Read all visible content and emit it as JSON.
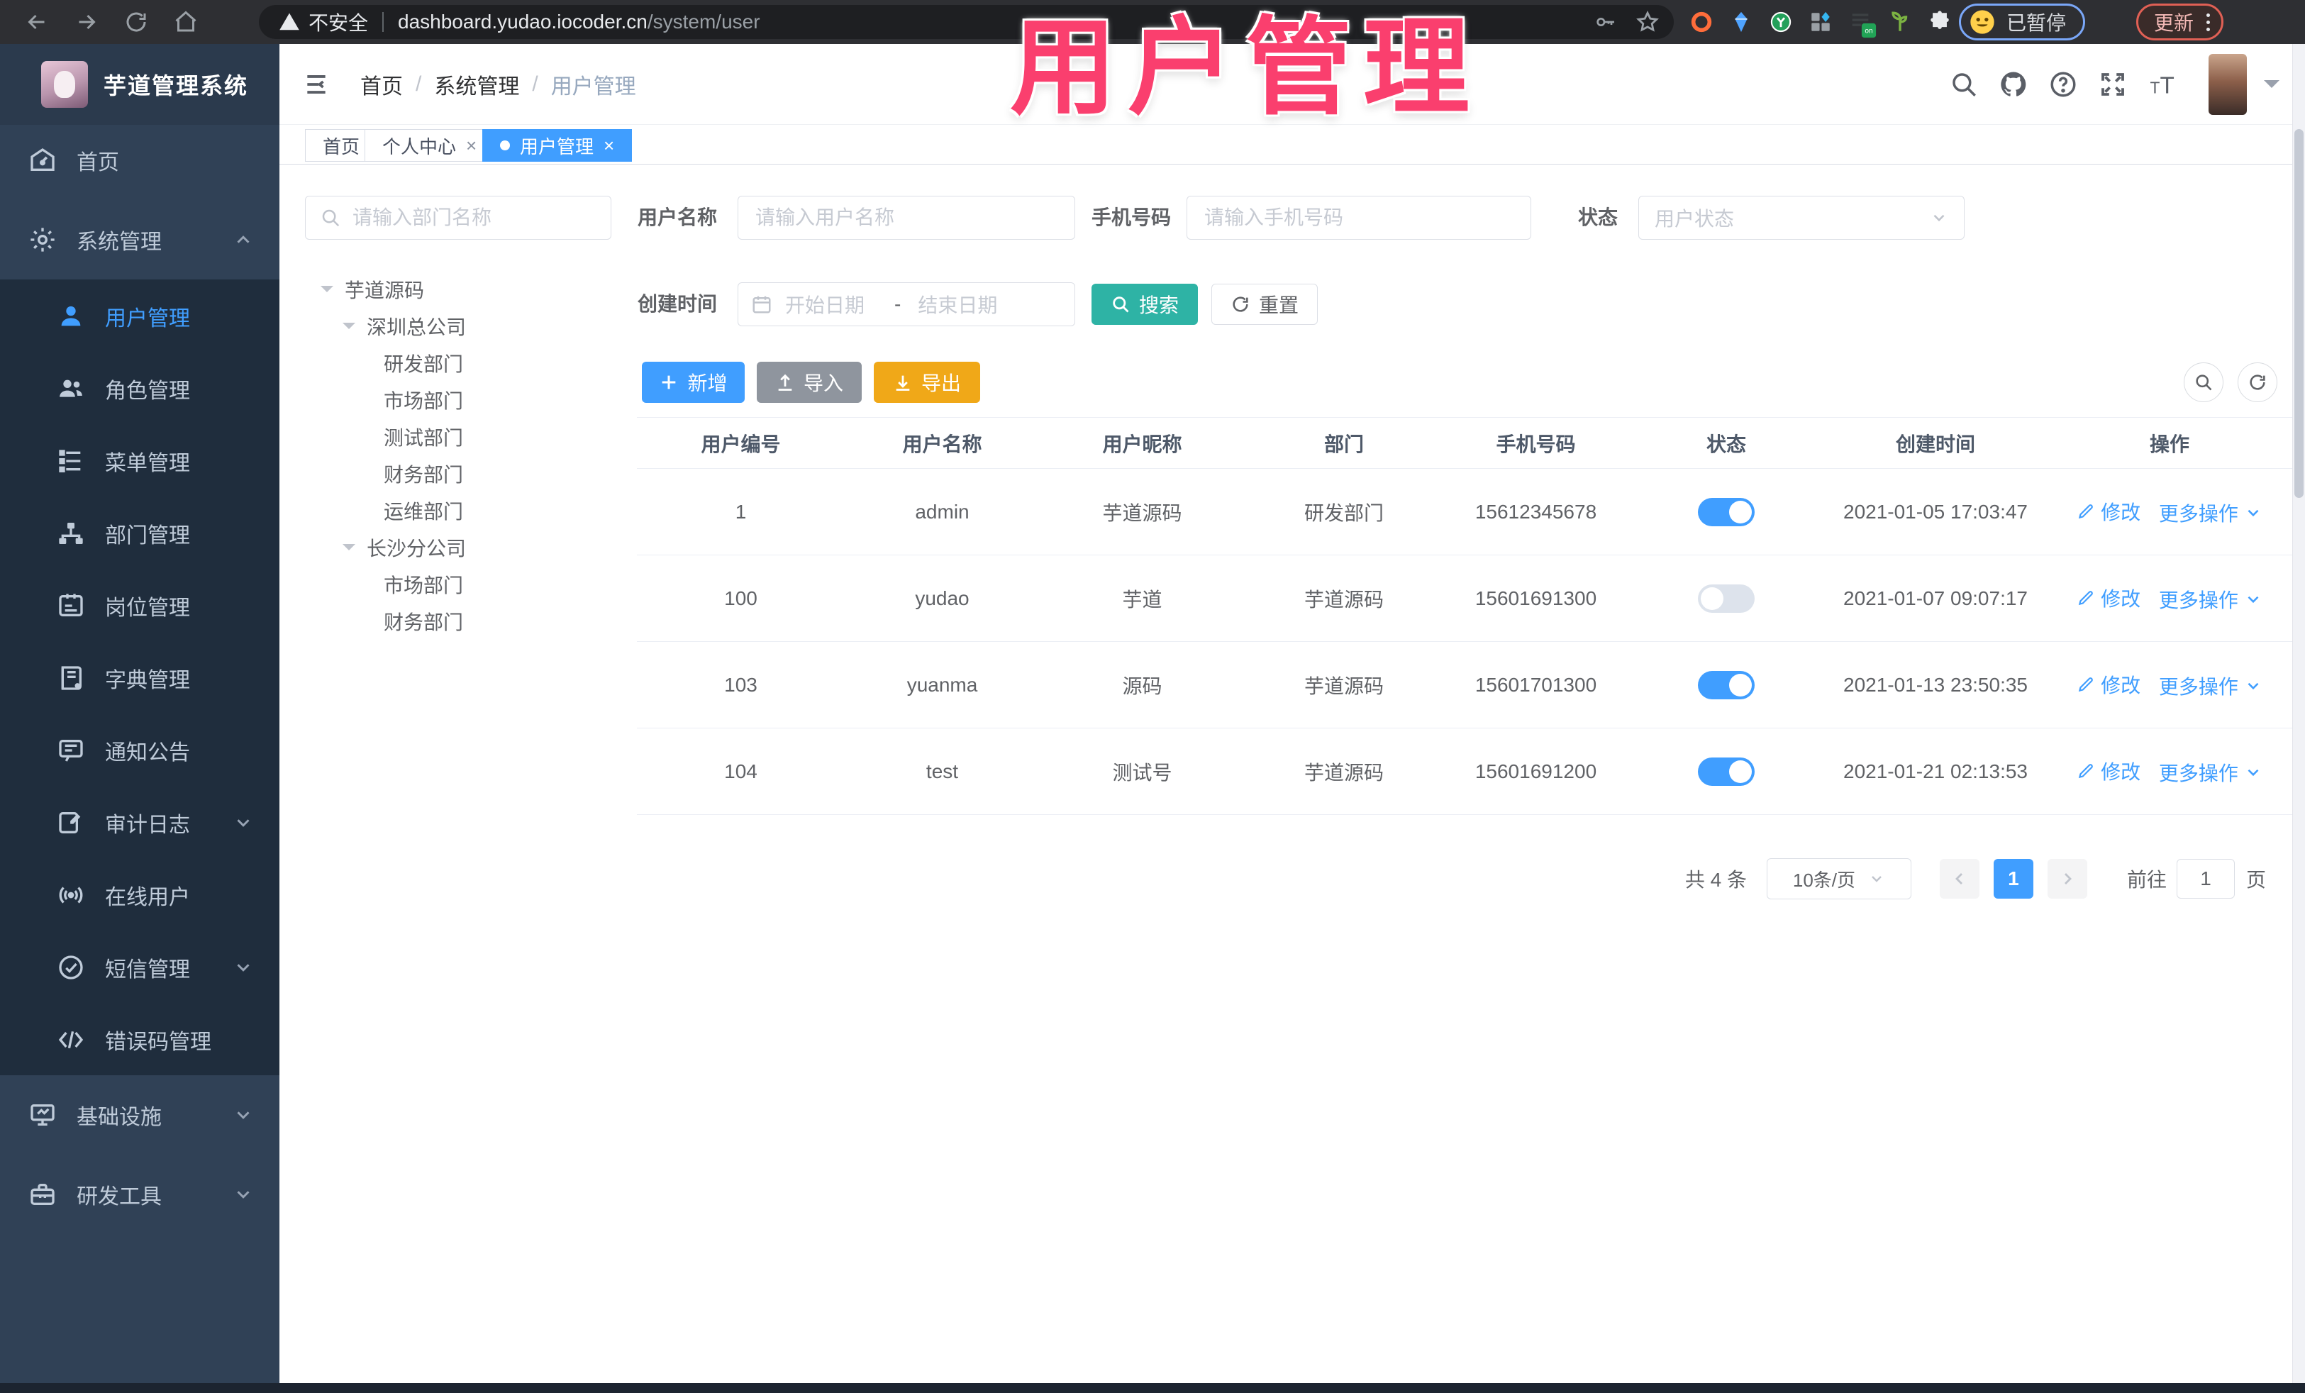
{
  "browser": {
    "security_label": "不安全",
    "url_host": "dashboard.yudao.iocoder.cn",
    "url_path": "/system/user",
    "profile_status": "已暂停",
    "update_label": "更新"
  },
  "overlay_title": "用户管理",
  "header": {
    "logo_title": "芋道管理系统",
    "breadcrumb": {
      "home": "首页",
      "section": "系统管理",
      "current": "用户管理",
      "separator": "/"
    }
  },
  "tabs": [
    {
      "label": "首页"
    },
    {
      "label": "个人中心",
      "close": "×"
    },
    {
      "label": "用户管理",
      "close": "×"
    }
  ],
  "sidebar": {
    "items": [
      {
        "label": "首页"
      },
      {
        "label": "系统管理"
      },
      {
        "label": "用户管理"
      },
      {
        "label": "角色管理"
      },
      {
        "label": "菜单管理"
      },
      {
        "label": "部门管理"
      },
      {
        "label": "岗位管理"
      },
      {
        "label": "字典管理"
      },
      {
        "label": "通知公告"
      },
      {
        "label": "审计日志"
      },
      {
        "label": "在线用户"
      },
      {
        "label": "短信管理"
      },
      {
        "label": "错误码管理"
      },
      {
        "label": "基础设施"
      },
      {
        "label": "研发工具"
      }
    ]
  },
  "dept": {
    "search_placeholder": "请输入部门名称",
    "nodes": [
      {
        "label": "芋道源码"
      },
      {
        "label": "深圳总公司"
      },
      {
        "label": "研发部门"
      },
      {
        "label": "市场部门"
      },
      {
        "label": "测试部门"
      },
      {
        "label": "财务部门"
      },
      {
        "label": "运维部门"
      },
      {
        "label": "长沙分公司"
      },
      {
        "label": "市场部门"
      },
      {
        "label": "财务部门"
      }
    ]
  },
  "filters": {
    "username_label": "用户名称",
    "username_placeholder": "请输入用户名称",
    "mobile_label": "手机号码",
    "mobile_placeholder": "请输入手机号码",
    "status_label": "状态",
    "status_placeholder": "用户状态",
    "created_label": "创建时间",
    "date_start_placeholder": "开始日期",
    "date_separator": "-",
    "date_end_placeholder": "结束日期",
    "search_label": "搜索",
    "reset_label": "重置"
  },
  "toolbar": {
    "add": "新增",
    "import": "导入",
    "export": "导出"
  },
  "table": {
    "columns": [
      "用户编号",
      "用户名称",
      "用户昵称",
      "部门",
      "手机号码",
      "状态",
      "创建时间",
      "操作"
    ],
    "action_edit": "修改",
    "action_more": "更多操作",
    "rows": [
      {
        "id": "1",
        "username": "admin",
        "nickname": "芋道源码",
        "dept": "研发部门",
        "mobile": "15612345678",
        "created": "2021-01-05 17:03:47",
        "switch_class": "switch on"
      },
      {
        "id": "100",
        "username": "yudao",
        "nickname": "芋道",
        "dept": "芋道源码",
        "mobile": "15601691300",
        "created": "2021-01-07 09:07:17",
        "switch_class": "switch off"
      },
      {
        "id": "103",
        "username": "yuanma",
        "nickname": "源码",
        "dept": "芋道源码",
        "mobile": "15601701300",
        "created": "2021-01-13 23:50:35",
        "switch_class": "switch on"
      },
      {
        "id": "104",
        "username": "test",
        "nickname": "测试号",
        "dept": "芋道源码",
        "mobile": "15601691200",
        "created": "2021-01-21 02:13:53",
        "switch_class": "switch on"
      }
    ]
  },
  "pagination": {
    "total": "共 4 条",
    "page_size": "10条/页",
    "current_page": "1",
    "goto_label": "前往",
    "goto_value": "1",
    "page_unit": "页"
  },
  "colors": {
    "accent": "#409EFF",
    "sidebar_bg": "#304156",
    "submenu_bg": "#1f2d3d",
    "search_button": "#2eb3a5",
    "export_button": "#f0a818",
    "overlay_pink": "#fa3f6e"
  }
}
